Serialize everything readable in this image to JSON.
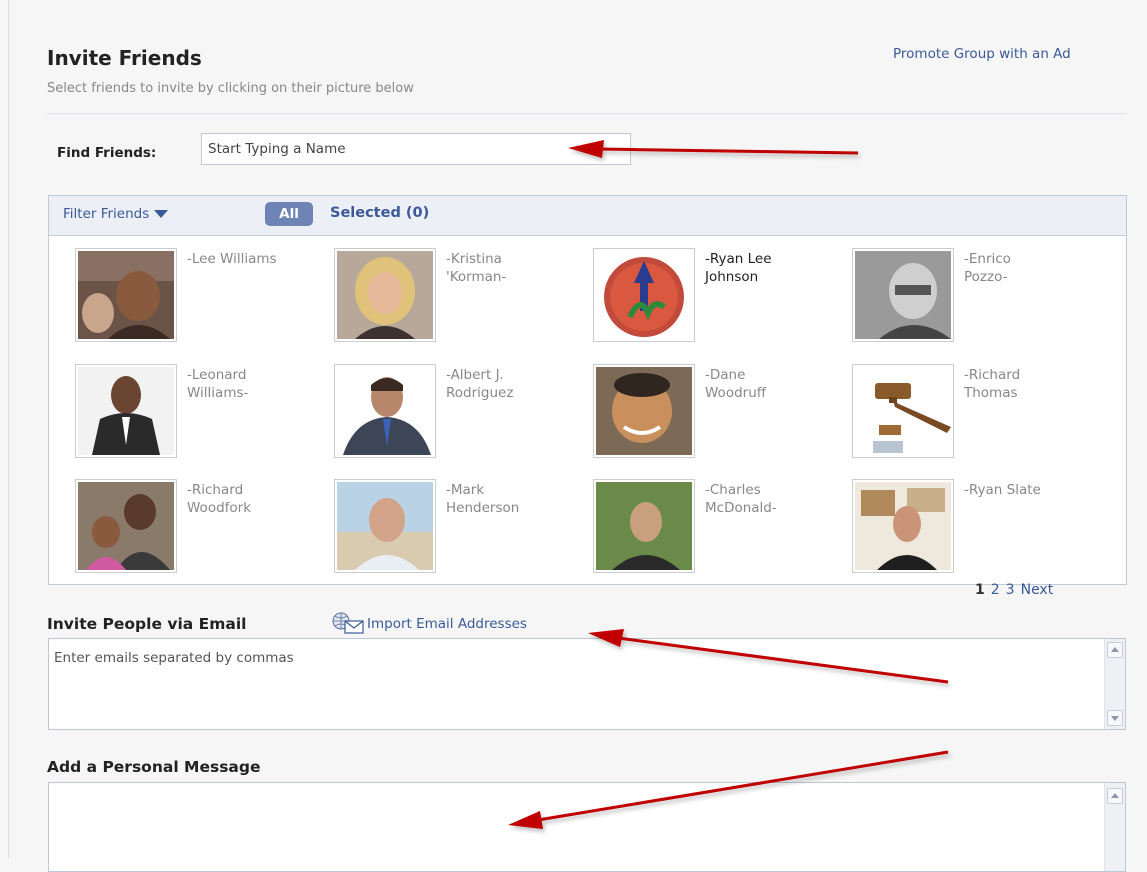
{
  "header": {
    "title": "Invite Friends",
    "subtitle": "Select friends to invite by clicking on their picture below",
    "promote_link": "Promote Group with an Ad"
  },
  "find": {
    "label": "Find Friends:",
    "placeholder": "Start Typing a Name"
  },
  "filter_bar": {
    "filter_label": "Filter Friends",
    "all_label": "All",
    "selected_label": "Selected (0)"
  },
  "friends": [
    {
      "line1": "-Lee Williams",
      "line2": ""
    },
    {
      "line1": "-Kristina",
      "line2": "'Korman-"
    },
    {
      "line1": "-Ryan Lee",
      "line2": "Johnson"
    },
    {
      "line1": "-Enrico",
      "line2": "Pozzo-"
    },
    {
      "line1": "-Leonard",
      "line2": "Williams-"
    },
    {
      "line1": "-Albert J.",
      "line2": "Rodriguez"
    },
    {
      "line1": "-Dane",
      "line2": "Woodruff"
    },
    {
      "line1": "-Richard",
      "line2": "Thomas"
    },
    {
      "line1": "-Richard",
      "line2": "Woodfork"
    },
    {
      "line1": "-Mark",
      "line2": "Henderson"
    },
    {
      "line1": "-Charles",
      "line2": "McDonald-"
    },
    {
      "line1": "-Ryan Slate",
      "line2": ""
    }
  ],
  "pager": {
    "current": "1",
    "page2": "2",
    "page3": "3",
    "next": "Next"
  },
  "email": {
    "label": "Invite People via Email",
    "import_link": "Import Email Addresses",
    "placeholder": "Enter emails separated by commas"
  },
  "message": {
    "label": "Add a Personal Message"
  },
  "colors": {
    "link": "#3b5998",
    "arrow": "#c00000",
    "button": "#6d84b4"
  }
}
